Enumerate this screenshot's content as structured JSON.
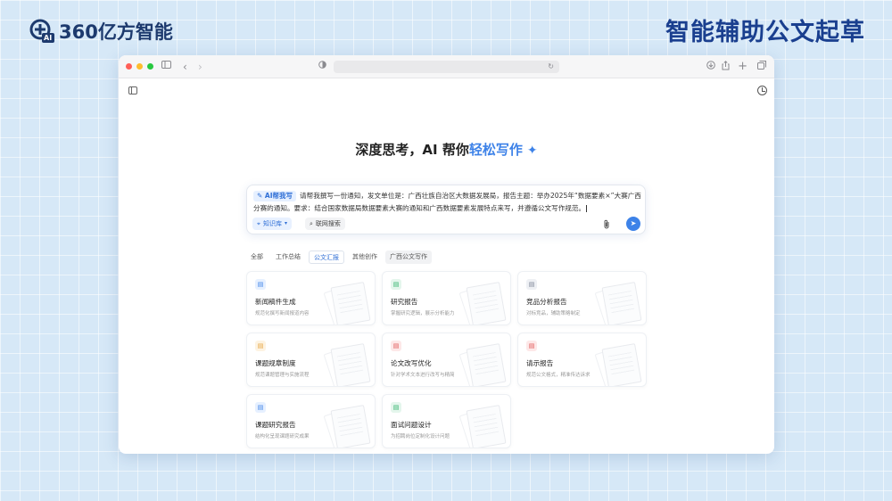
{
  "brand": {
    "name": "360亿方智能",
    "logo_text": "AI"
  },
  "headline": "智能辅助公文起草",
  "colors": {
    "accent": "#3d82e8",
    "headline": "#1a3f8f",
    "background": "#d6e8f7"
  },
  "window": {
    "traffic_lights": [
      "#ff5f57",
      "#febc2e",
      "#28c840"
    ],
    "hero": {
      "prefix": "深度思考，AI 帮你",
      "highlight": "轻松写作"
    },
    "prompt": {
      "tag": "AI帮我写",
      "text": "请帮我撰写一份通知，发文单位是：广西壮族自治区大数据发展局，报告主题：举办2025年“数据要素×”大赛广西分赛的通知。要求：结合国家数据局数据要素大赛的通知和广西数据要素发展特点来写，并遵循公文写作规范。",
      "chip_knowledge": "知识库",
      "chip_web": "联网搜索"
    },
    "tabs": [
      {
        "label": "全部",
        "active": false
      },
      {
        "label": "工作总结",
        "active": false
      },
      {
        "label": "公文汇报",
        "active": true
      },
      {
        "label": "其他创作",
        "active": false
      },
      {
        "label": "广西公文写作",
        "active": false
      }
    ],
    "cards": [
      {
        "title": "新闻稿件生成",
        "desc": "规范化撰写新闻报道内容",
        "icon": "document-icon",
        "color": "#3d82e8"
      },
      {
        "title": "研究报告",
        "desc": "掌握研究逻辑，展示分析能力",
        "icon": "document-icon",
        "color": "#2fb36b"
      },
      {
        "title": "竞品分析报告",
        "desc": "对标竞品，辅助策略制定",
        "icon": "document-icon",
        "color": "#7b8494"
      },
      {
        "title": "课题规章制度",
        "desc": "规范课题管理与实施流程",
        "icon": "document-icon",
        "color": "#e6a23c"
      },
      {
        "title": "论文改写优化",
        "desc": "针对学术文本进行改写与精简",
        "icon": "document-icon",
        "color": "#e05656"
      },
      {
        "title": "请示报告",
        "desc": "规范公文格式，精准传达诉求",
        "icon": "document-icon",
        "color": "#e05656"
      },
      {
        "title": "课题研究报告",
        "desc": "结构化呈现课题研究成果",
        "icon": "document-icon",
        "color": "#3d82e8"
      },
      {
        "title": "面试问题设计",
        "desc": "为招聘岗位定制化设计问题",
        "icon": "document-icon",
        "color": "#2fb36b"
      }
    ]
  }
}
